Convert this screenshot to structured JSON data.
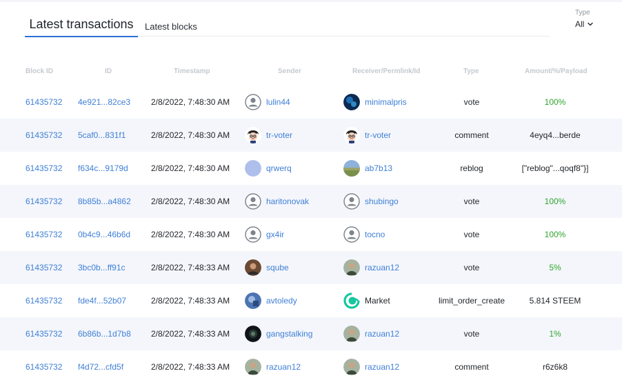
{
  "tabs": [
    {
      "label": "Latest transactions",
      "active": true
    },
    {
      "label": "Latest blocks",
      "active": false
    }
  ],
  "filter": {
    "label": "Type",
    "value": "All"
  },
  "columns": [
    "Block ID",
    "ID",
    "Timestamp",
    "Sender",
    "Receiver/Permlink/Id",
    "Type",
    "Amount/%/Payload"
  ],
  "colors": {
    "accent": "#2b6fd6",
    "link": "#3f7fd6",
    "positive": "#2fa52f",
    "row_alt": "#f4f6fb"
  },
  "rows": [
    {
      "block": "61435732",
      "id": "4e921...82ce3",
      "timestamp": "2/8/2022, 7:48:30 AM",
      "sender": "lulin44",
      "sender_avatar": "default-user-icon",
      "receiver": "minimalpris",
      "receiver_avatar": "photo-blue",
      "type": "vote",
      "amount": "100%",
      "amount_style": "green",
      "receiver_style": "link"
    },
    {
      "block": "61435732",
      "id": "5caf0...831f1",
      "timestamp": "2/8/2022, 7:48:30 AM",
      "sender": "tr-voter",
      "sender_avatar": "cartoon-face",
      "receiver": "tr-voter",
      "receiver_avatar": "cartoon-face",
      "type": "comment",
      "amount": "4eyq4...berde",
      "amount_style": "plain",
      "receiver_style": "link"
    },
    {
      "block": "61435732",
      "id": "f634c...9179d",
      "timestamp": "2/8/2022, 7:48:30 AM",
      "sender": "qrwerq",
      "sender_avatar": "solid-lavender",
      "receiver": "ab7b13",
      "receiver_avatar": "photo-landscape",
      "type": "reblog",
      "amount": "[\"reblog\"...qoqf8\"}]",
      "amount_style": "plain",
      "receiver_style": "link"
    },
    {
      "block": "61435732",
      "id": "8b85b...a4862",
      "timestamp": "2/8/2022, 7:48:30 AM",
      "sender": "haritonovak",
      "sender_avatar": "default-user-icon",
      "receiver": "shubingo",
      "receiver_avatar": "default-user-icon",
      "type": "vote",
      "amount": "100%",
      "amount_style": "green",
      "receiver_style": "link"
    },
    {
      "block": "61435732",
      "id": "0b4c9...46b6d",
      "timestamp": "2/8/2022, 7:48:30 AM",
      "sender": "gx4ir",
      "sender_avatar": "default-user-icon",
      "receiver": "tocno",
      "receiver_avatar": "default-user-icon",
      "type": "vote",
      "amount": "100%",
      "amount_style": "green",
      "receiver_style": "link"
    },
    {
      "block": "61435732",
      "id": "3bc0b...ff91c",
      "timestamp": "2/8/2022, 7:48:33 AM",
      "sender": "sqube",
      "sender_avatar": "photo-person",
      "receiver": "razuan12",
      "receiver_avatar": "photo-person-2",
      "type": "vote",
      "amount": "5%",
      "amount_style": "green",
      "receiver_style": "link"
    },
    {
      "block": "61435732",
      "id": "fde4f...52b07",
      "timestamp": "2/8/2022, 7:48:33 AM",
      "sender": "avtoledy",
      "sender_avatar": "photo-blue-2",
      "receiver": "Market",
      "receiver_avatar": "market-icon",
      "type": "limit_order_create",
      "amount": "5.814 STEEM",
      "amount_style": "plain",
      "receiver_style": "plain"
    },
    {
      "block": "61435732",
      "id": "6b86b...1d7b8",
      "timestamp": "2/8/2022, 7:48:33 AM",
      "sender": "gangstalking",
      "sender_avatar": "photo-dark",
      "receiver": "razuan12",
      "receiver_avatar": "photo-person-2",
      "type": "vote",
      "amount": "1%",
      "amount_style": "green",
      "receiver_style": "link"
    },
    {
      "block": "61435732",
      "id": "f4d72...cfd5f",
      "timestamp": "2/8/2022, 7:48:33 AM",
      "sender": "razuan12",
      "sender_avatar": "photo-person-2",
      "receiver": "razuan12",
      "receiver_avatar": "photo-person-2",
      "type": "comment",
      "amount": "r6z6k8",
      "amount_style": "plain",
      "receiver_style": "link"
    }
  ]
}
